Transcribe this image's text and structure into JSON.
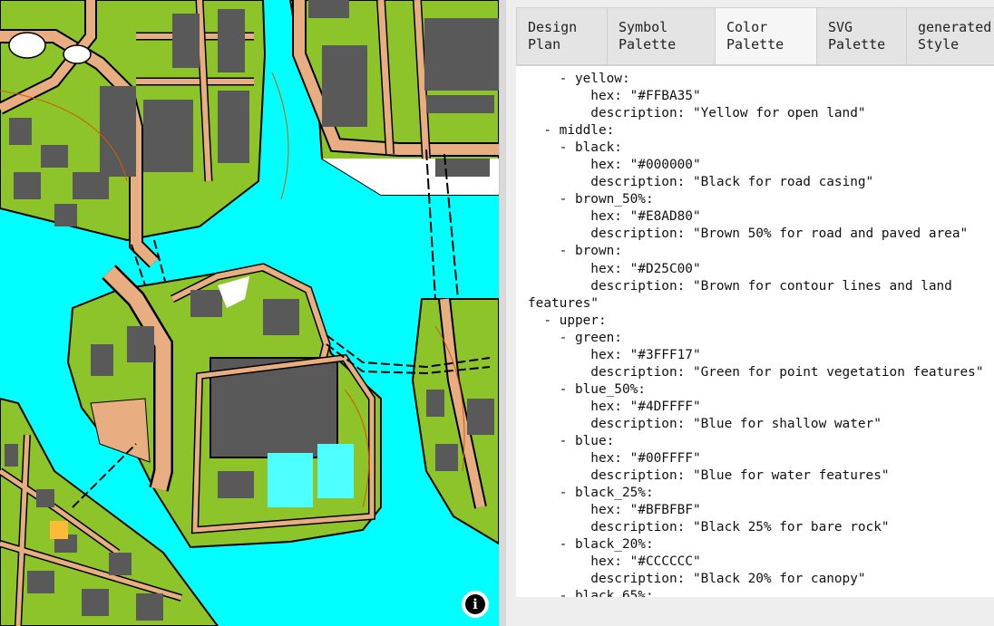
{
  "tabs": [
    {
      "label": "Design\nPlan",
      "active": false
    },
    {
      "label": "Symbol\nPalette",
      "active": false
    },
    {
      "label": "Color\nPalette",
      "active": true
    },
    {
      "label": "SVG\nPalette",
      "active": false
    },
    {
      "label": "generated\nStyle",
      "active": false
    }
  ],
  "yaml_text": "    - yellow:\n        hex: \"#FFBA35\"\n        description: \"Yellow for open land\"\n  - middle:\n    - black:\n        hex: \"#000000\"\n        description: \"Black for road casing\"\n    - brown_50%:\n        hex: \"#E8AD80\"\n        description: \"Brown 50% for road and paved area\"\n    - brown:\n        hex: \"#D25C00\"\n        description: \"Brown for contour lines and land\nfeatures\"\n  - upper:\n    - green:\n        hex: \"#3FFF17\"\n        description: \"Green for point vegetation features\"\n    - blue_50%:\n        hex: \"#4DFFFF\"\n        description: \"Blue for shallow water\"\n    - blue:\n        hex: \"#00FFFF\"\n        description: \"Blue for water features\"\n    - black_25%:\n        hex: \"#BFBFBF\"\n        description: \"Black 25% for bare rock\"\n    - black_20%:\n        hex: \"#CCCCCC\"\n        description: \"Black 20% for canopy\"\n    - black_65%:",
  "info_button": {
    "glyph": "i",
    "icon": "info-icon"
  },
  "map_colors": {
    "water": "#00FFFF",
    "land": "#8CC42A",
    "building": "#595959",
    "road": "#E8AD80",
    "casing": "#000000",
    "contour": "#D25C00",
    "open": "#FFFFFF",
    "sand": "#E8AD80",
    "yellow": "#FFBA35"
  }
}
